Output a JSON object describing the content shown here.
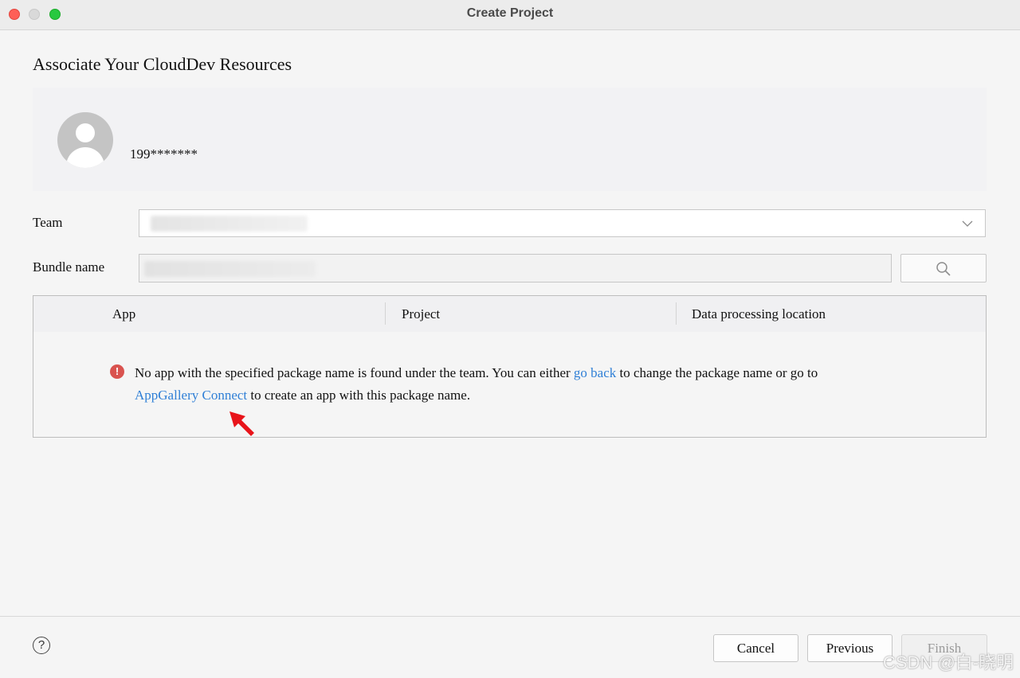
{
  "window": {
    "title": "Create Project"
  },
  "page": {
    "title": "Associate Your CloudDev Resources"
  },
  "account": {
    "name": "199*******"
  },
  "form": {
    "team_label": "Team",
    "team_value": "",
    "bundle_label": "Bundle name",
    "bundle_value": ""
  },
  "table": {
    "columns": [
      "App",
      "Project",
      "Data processing location"
    ]
  },
  "error": {
    "part1": "No app with the specified package name is found under the team. You can either ",
    "go_back_link": "go back",
    "part2": " to change the package name or go to ",
    "appgallery_link": "AppGallery Connect",
    "part3": " to create an app with this package name."
  },
  "footer": {
    "help_symbol": "?",
    "cancel_label": "Cancel",
    "previous_label": "Previous",
    "finish_label": "Finish",
    "watermark": "CSDN @白-晓明"
  },
  "colors": {
    "link": "#2f7fd6",
    "error": "#d9534f",
    "annotation_arrow": "#e8141a"
  }
}
